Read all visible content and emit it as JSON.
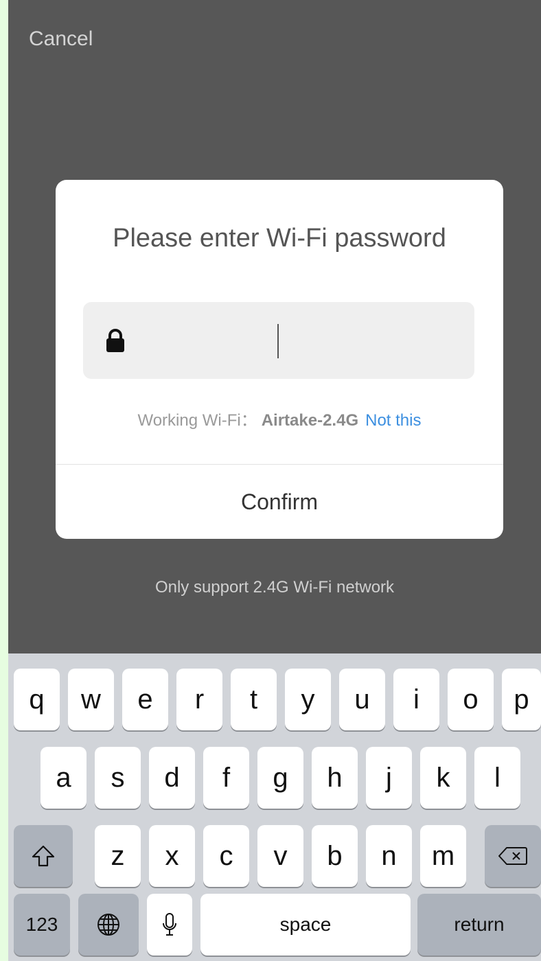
{
  "header": {
    "cancel_label": "Cancel"
  },
  "dialog": {
    "title": "Please enter Wi-Fi password",
    "password_value": "",
    "working_label": "Working Wi-Fi：",
    "ssid": "Airtake-2.4G",
    "not_this_label": "Not this",
    "confirm_label": "Confirm"
  },
  "note": "Only support 2.4G Wi-Fi network",
  "keyboard": {
    "row1": [
      "q",
      "w",
      "e",
      "r",
      "t",
      "y",
      "u",
      "i",
      "o",
      "p"
    ],
    "row2": [
      "a",
      "s",
      "d",
      "f",
      "g",
      "h",
      "j",
      "k",
      "l"
    ],
    "row3": [
      "z",
      "x",
      "c",
      "v",
      "b",
      "n",
      "m"
    ],
    "numbers_label": "123",
    "space_label": "space",
    "return_label": "return",
    "icons": {
      "shift": "shift-icon",
      "backspace": "backspace-icon",
      "globe": "globe-icon",
      "mic": "mic-icon"
    }
  },
  "colors": {
    "link": "#3c8fe0",
    "overlay": "#575757",
    "keyboard_bg": "#d1d4d9"
  }
}
